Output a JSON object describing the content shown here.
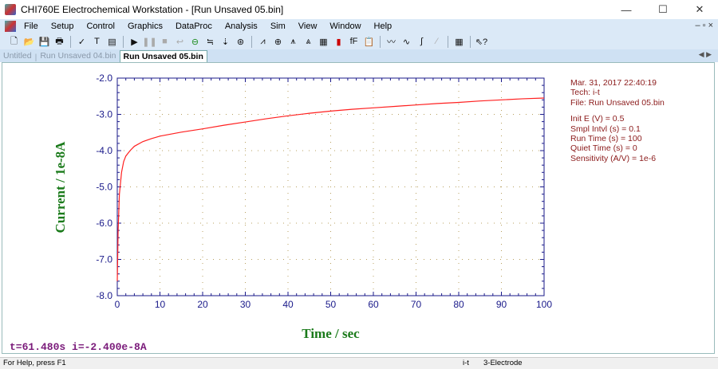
{
  "window": {
    "title": "CHI760E Electrochemical Workstation - [Run Unsaved  05.bin]",
    "controls": [
      "—",
      "☐",
      "✕"
    ]
  },
  "menu": [
    "File",
    "Setup",
    "Control",
    "Graphics",
    "DataProc",
    "Analysis",
    "Sim",
    "View",
    "Window",
    "Help"
  ],
  "mdi_controls": "–  ▫  ×",
  "toolbar": [
    "new-icon",
    "open-icon",
    "save-icon",
    "print-icon",
    "technique-icon",
    "text-icon",
    "parameters-icon",
    "run-icon",
    "pause-icon",
    "stop-icon",
    "reverse-icon",
    "ir-comp-icon",
    "filter-icon",
    "cell-icon",
    "rotate-icon",
    "graph-icon",
    "zoom-icon",
    "peak-icon",
    "peak-def-icon",
    "options-icon",
    "color-icon",
    "font-icon",
    "clipboard-icon",
    "smooth-icon",
    "derivative-icon",
    "integrate-icon",
    "interpolate-icon",
    "table-icon",
    "help-icon"
  ],
  "tabs": [
    {
      "label": "Untitled",
      "active": false
    },
    {
      "label": "Run Unsaved  04.bin",
      "active": false
    },
    {
      "label": "Run Unsaved  05.bin",
      "active": true
    }
  ],
  "info": {
    "date": "Mar. 31, 2017    22:40:19",
    "tech": "Tech: i-t",
    "file": "File: Run Unsaved  05.bin",
    "params": [
      "Init E (V) = 0.5",
      "Smpl Intvl (s) = 0.1",
      "Run Time (s) = 100",
      "Quiet Time (s) = 0",
      "Sensitivity (A/V) = 1e-6"
    ]
  },
  "readout": "t=61.480s   i=-2.400e-8A",
  "status": {
    "help": "For Help, press F1",
    "tech": "i-t",
    "electrode": "3-Electrode"
  },
  "colors": {
    "curve": "#ff2020",
    "axis_label": "#1a7a1a",
    "tick": "#1a1a8a",
    "info": "#8b1a1a"
  },
  "chart_data": {
    "type": "line",
    "xlabel": "Time / sec",
    "ylabel": "Current / 1e-8A",
    "xlim": [
      0,
      100
    ],
    "ylim": [
      -8.0,
      -2.0
    ],
    "xticks": [
      "0",
      "10",
      "20",
      "30",
      "40",
      "50",
      "60",
      "70",
      "80",
      "90",
      "100"
    ],
    "yticks": [
      "-2.0",
      "-3.0",
      "-4.0",
      "-5.0",
      "-6.0",
      "-7.0",
      "-8.0"
    ],
    "grid": true,
    "series": [
      {
        "name": "i-t",
        "x": [
          0,
          0.2,
          0.5,
          1,
          1.5,
          2,
          3,
          4,
          6,
          8,
          10,
          15,
          20,
          25,
          30,
          35,
          40,
          45,
          50,
          55,
          60,
          65,
          70,
          75,
          80,
          85,
          90,
          95,
          100
        ],
        "y": [
          -7.6,
          -6.2,
          -5.2,
          -4.6,
          -4.3,
          -4.15,
          -4.0,
          -3.88,
          -3.75,
          -3.67,
          -3.6,
          -3.49,
          -3.4,
          -3.3,
          -3.21,
          -3.12,
          -3.04,
          -2.97,
          -2.91,
          -2.86,
          -2.82,
          -2.78,
          -2.74,
          -2.7,
          -2.67,
          -2.63,
          -2.6,
          -2.57,
          -2.55
        ]
      }
    ]
  }
}
